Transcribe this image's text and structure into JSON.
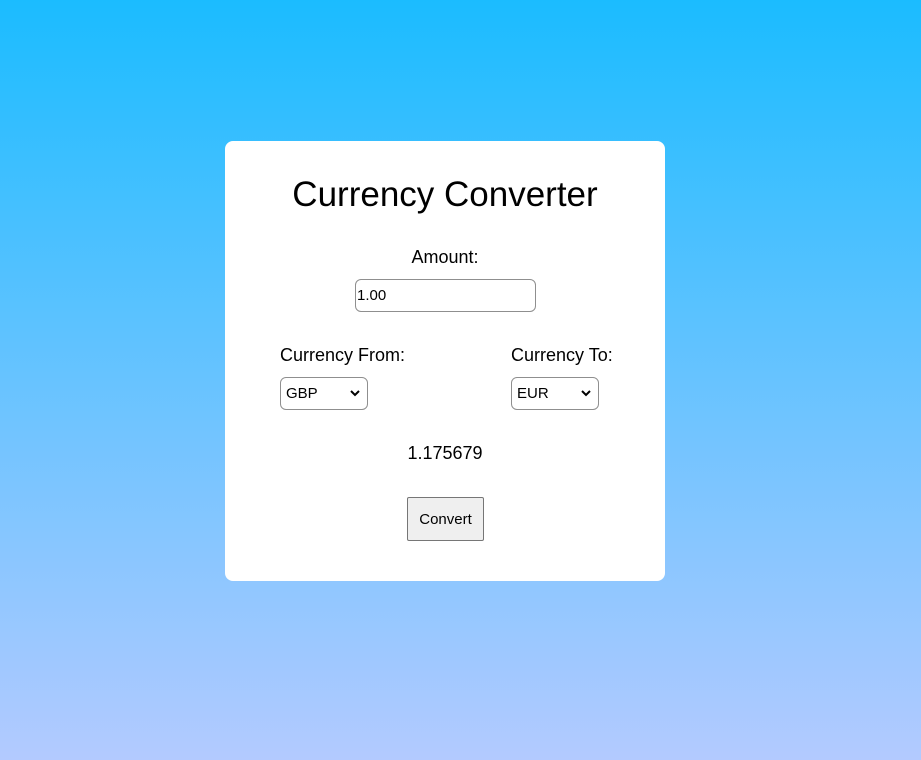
{
  "converter": {
    "title": "Currency Converter",
    "amount_label": "Amount:",
    "amount_value": "1.00",
    "from_label": "Currency From:",
    "from_selected": "GBP",
    "to_label": "Currency To:",
    "to_selected": "EUR",
    "result": "1.175679",
    "convert_label": "Convert"
  },
  "icons": {
    "dropdown": "chevron-down-icon"
  },
  "colors": {
    "background_top": "#1bbcff",
    "background_bottom": "#b3caff",
    "card": "#ffffff"
  }
}
